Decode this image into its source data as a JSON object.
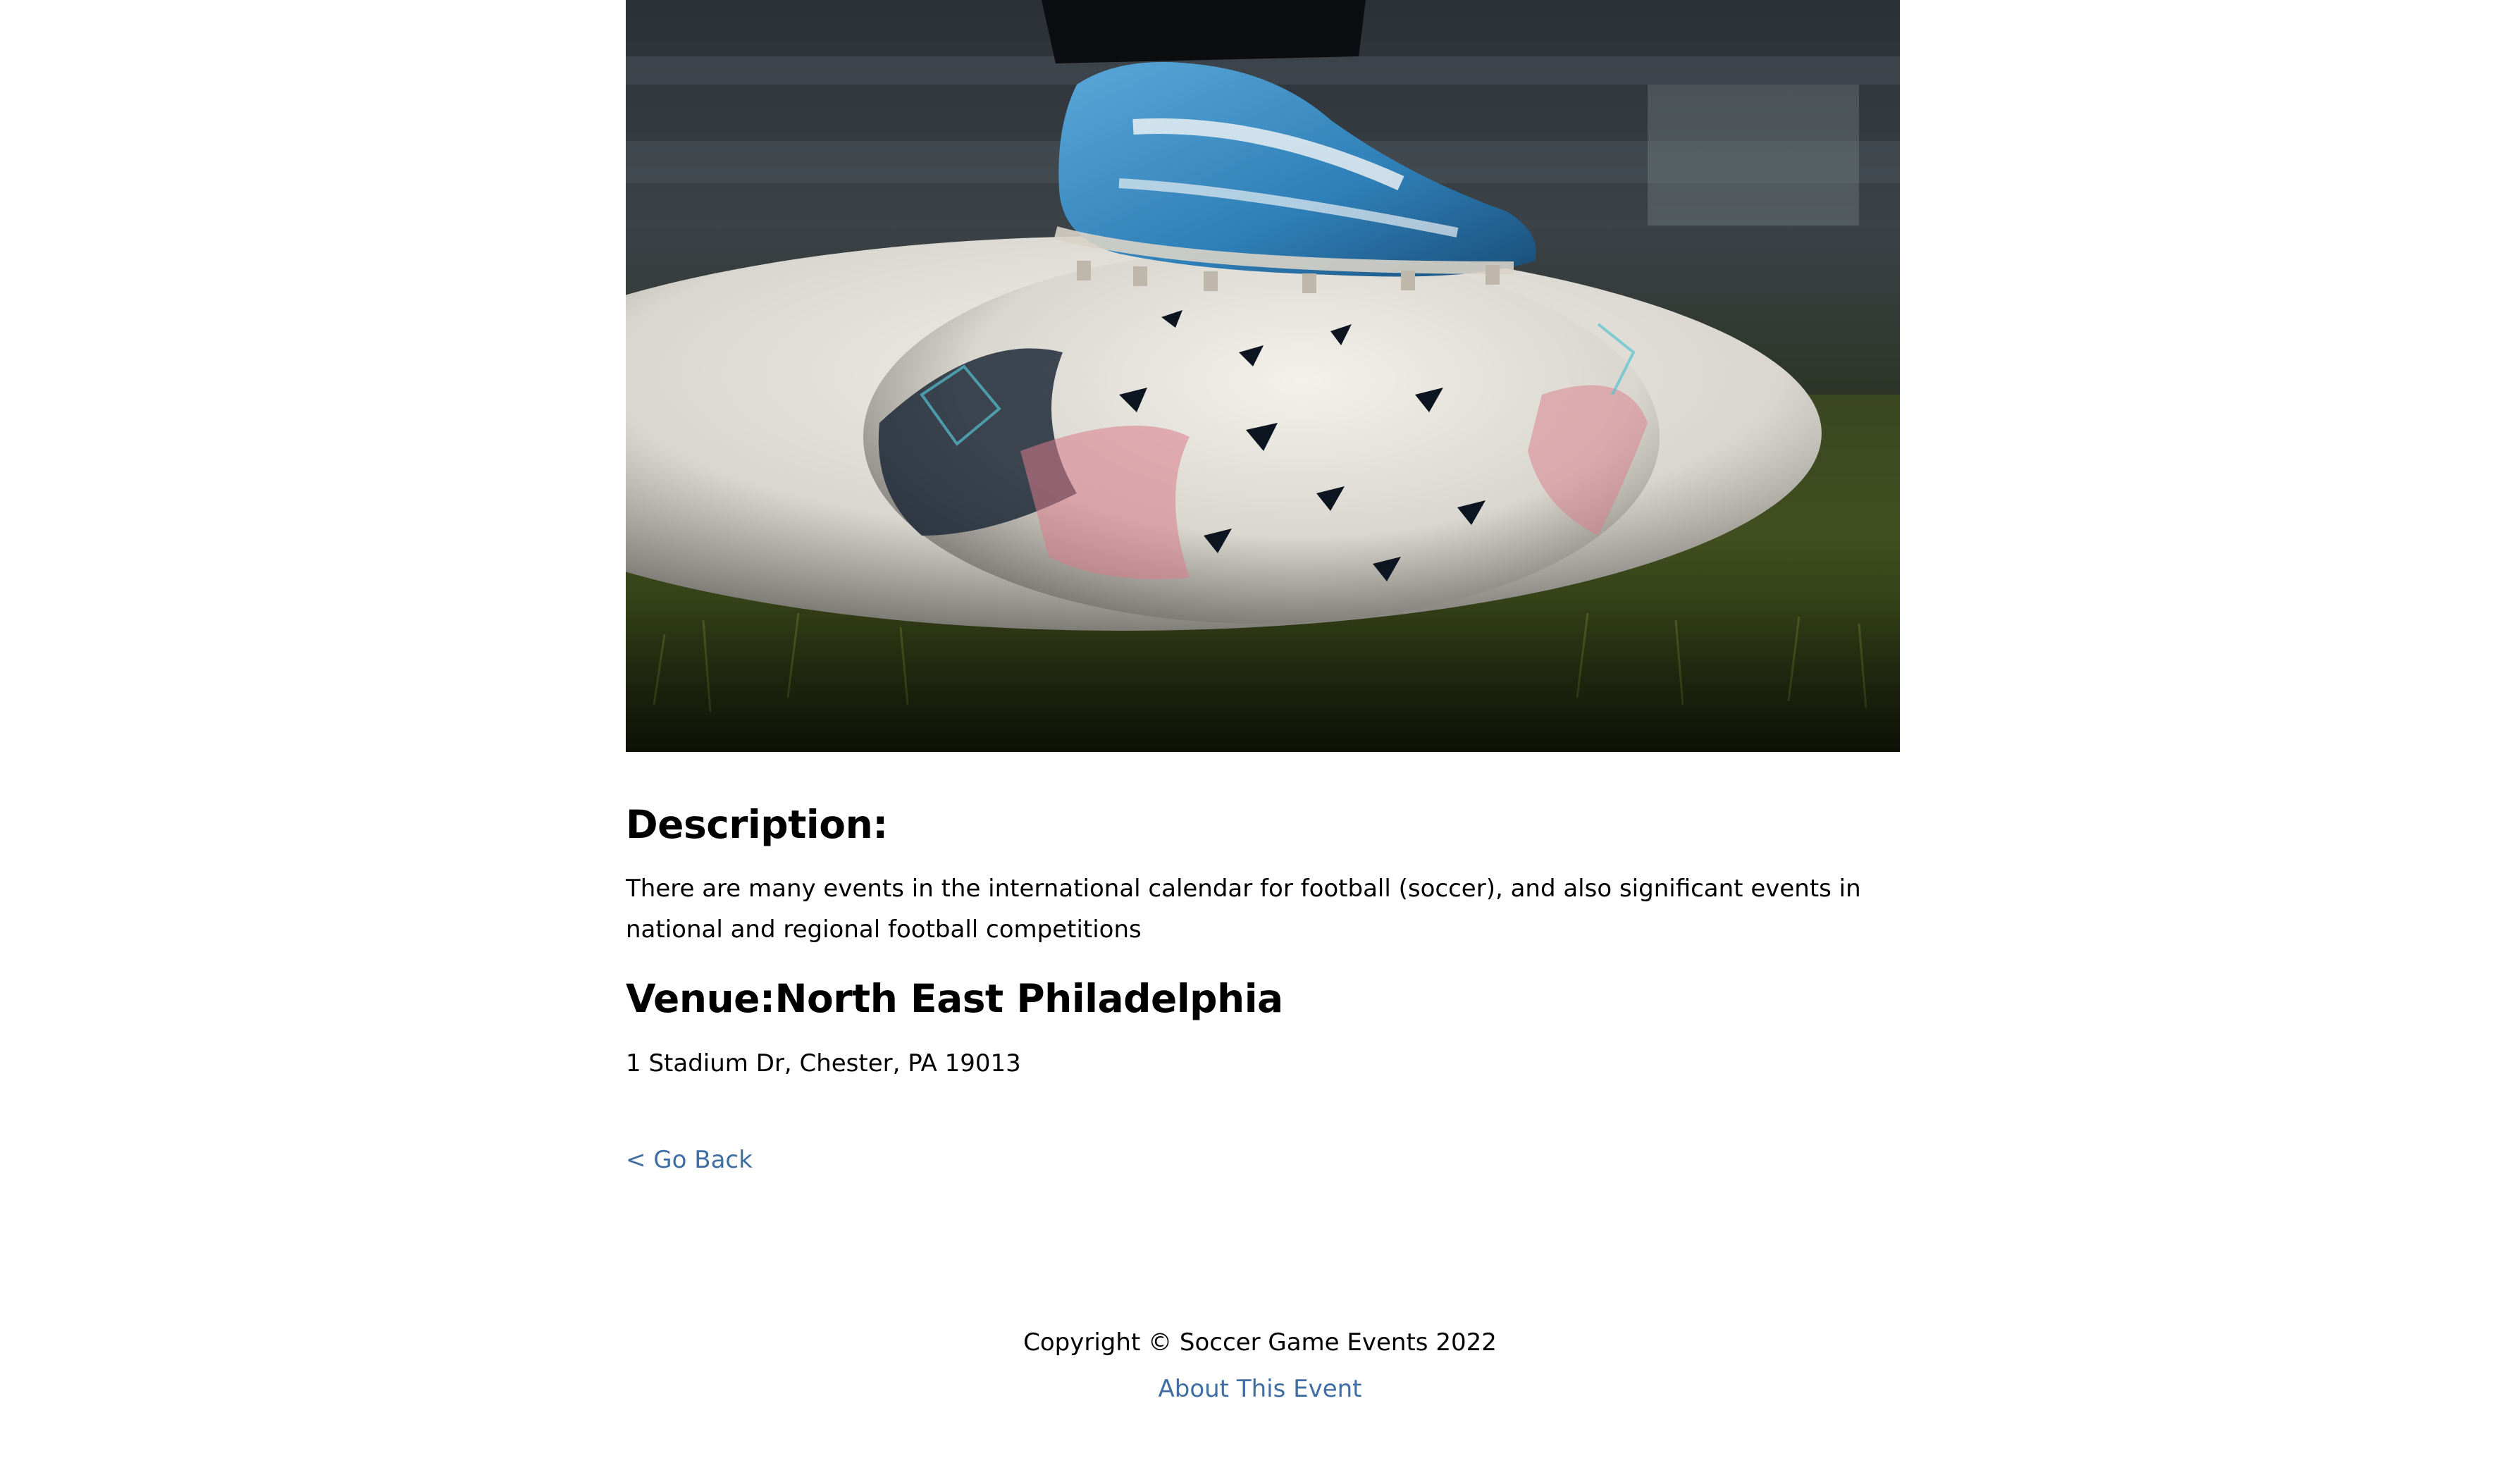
{
  "hero": {
    "image_alt": "Soccer cleat resting on a soccer ball on grass"
  },
  "description": {
    "heading": "Description:",
    "text": "There are many events in the international calendar for football (soccer), and also significant events in national and regional football competitions"
  },
  "venue": {
    "heading": "Venue:North East Philadelphia",
    "address": "1 Stadium Dr, Chester, PA 19013"
  },
  "navigation": {
    "go_back": "< Go Back"
  },
  "footer": {
    "copyright": "Copyright © Soccer Game Events 2022",
    "about_link": "About This Event"
  },
  "colors": {
    "link": "#3f6ea4",
    "text": "#000000",
    "background": "#ffffff"
  }
}
